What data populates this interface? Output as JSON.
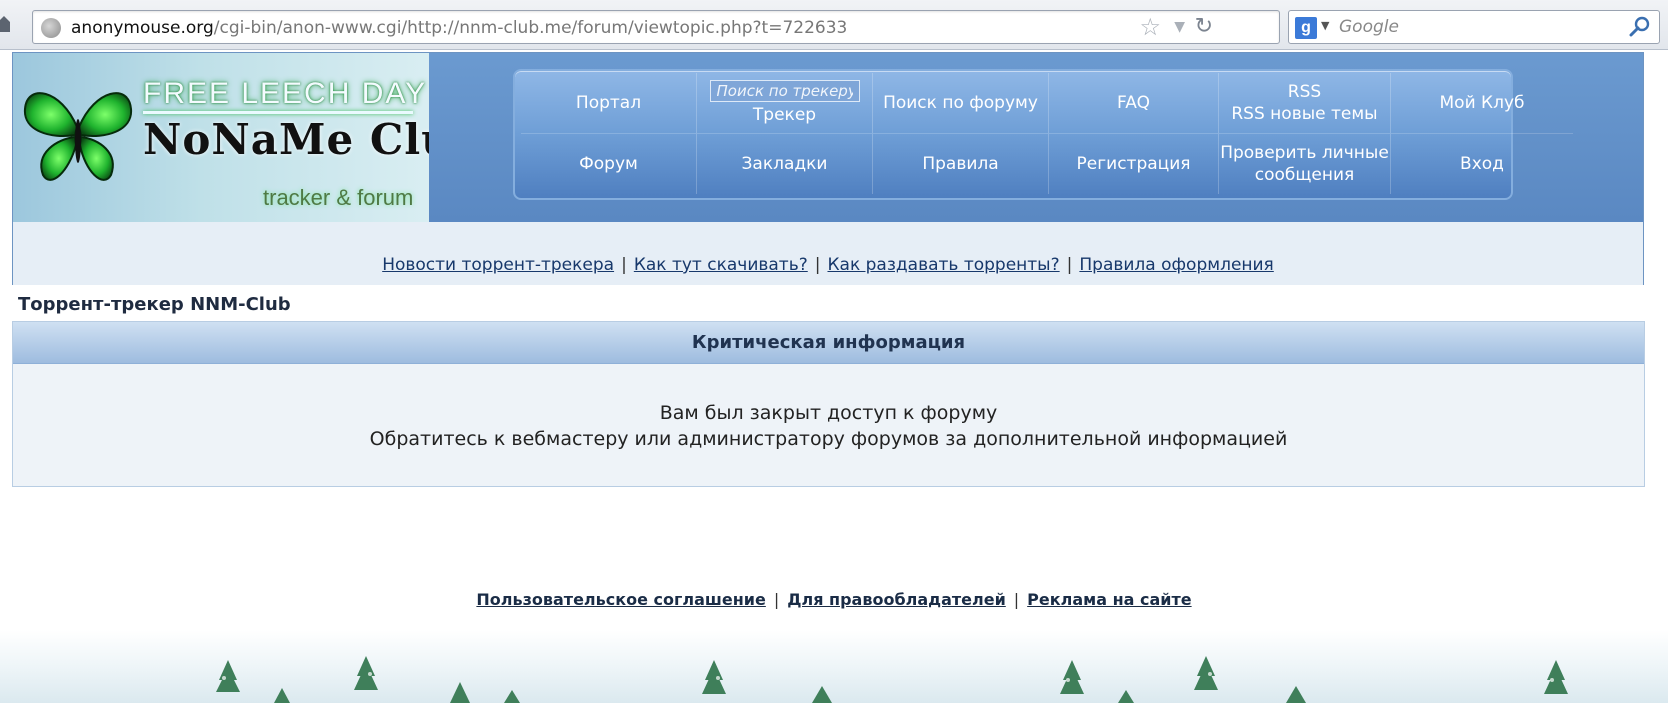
{
  "browser": {
    "url_domain": "anonymouse.org",
    "url_path": "/cgi-bin/anon-www.cgi/http://nnm-club.me/forum/viewtopic.php?t=722633",
    "search_engine_letter": "g",
    "search_placeholder": "Google"
  },
  "logo": {
    "banner": "FREE LEECH DAY",
    "name": "NoNaMe Club",
    "tagline": "tracker & forum"
  },
  "nav": {
    "portal": "Портал",
    "tracker_search_placeholder": "Поиск по трекеру",
    "tracker": "Трекер",
    "forum_search": "Поиск по форуму",
    "faq": "FAQ",
    "rss": "RSS",
    "rss_new": "RSS новые темы",
    "my_club": "Мой Клуб",
    "forum": "Форум",
    "bookmarks": "Закладки",
    "rules": "Правила",
    "register": "Регистрация",
    "check_pm_line1": "Проверить личные",
    "check_pm_line2": "сообщения",
    "login": "Вход"
  },
  "header_links": {
    "news": "Новости торрент-трекера",
    "how_download": "Как тут скачивать?",
    "how_seed": "Как раздавать торренты?",
    "format_rules": "Правила оформления",
    "separator": "|"
  },
  "page": {
    "site_title": "Торрент-трекер NNM-Club",
    "critical_title": "Критическая информация",
    "message_line1": "Вам был закрыт доступ к форуму",
    "message_line2": "Обратитесь к вебмастеру или администратору форумов за дополнительной информацией"
  },
  "footer": {
    "user_agreement": "Пользовательское соглашение",
    "rightholders": "Для правообладателей",
    "ads": "Реклама на сайте",
    "separator": "|"
  },
  "icons": {
    "site": "globe-icon",
    "bookmark": "star-icon",
    "history": "dropdown-icon",
    "reload": "reload-icon",
    "search": "magnifier-icon"
  },
  "colors": {
    "nav_blue": "#5a88c2",
    "link_blue": "#17386b",
    "panel_bg": "#eef3f8"
  }
}
